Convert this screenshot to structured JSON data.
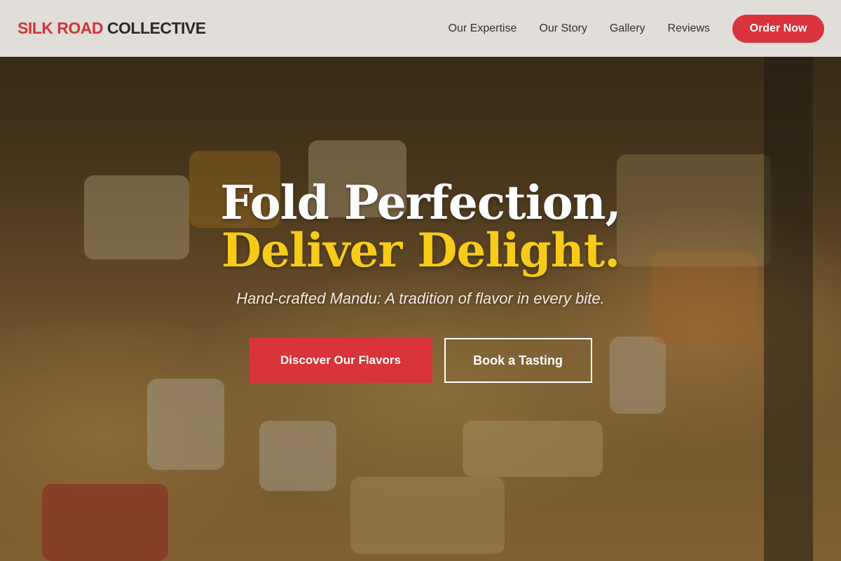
{
  "header": {
    "brand_part1": "SILK ROAD",
    "brand_part2": "COLLECTIVE",
    "nav": [
      "Our Expertise",
      "Our Story",
      "Gallery",
      "Reviews"
    ],
    "order_label": "Order Now"
  },
  "hero": {
    "headline_line1": "Fold Perfection,",
    "headline_line2": "Deliver Delight.",
    "tagline": "Hand-crafted Mandu: A tradition of flavor in every bite.",
    "primary_cta": "Discover Our Flavors",
    "secondary_cta": "Book a Tasting"
  },
  "colors": {
    "accent_red": "#d9343b",
    "accent_yellow": "#f7cb18"
  }
}
